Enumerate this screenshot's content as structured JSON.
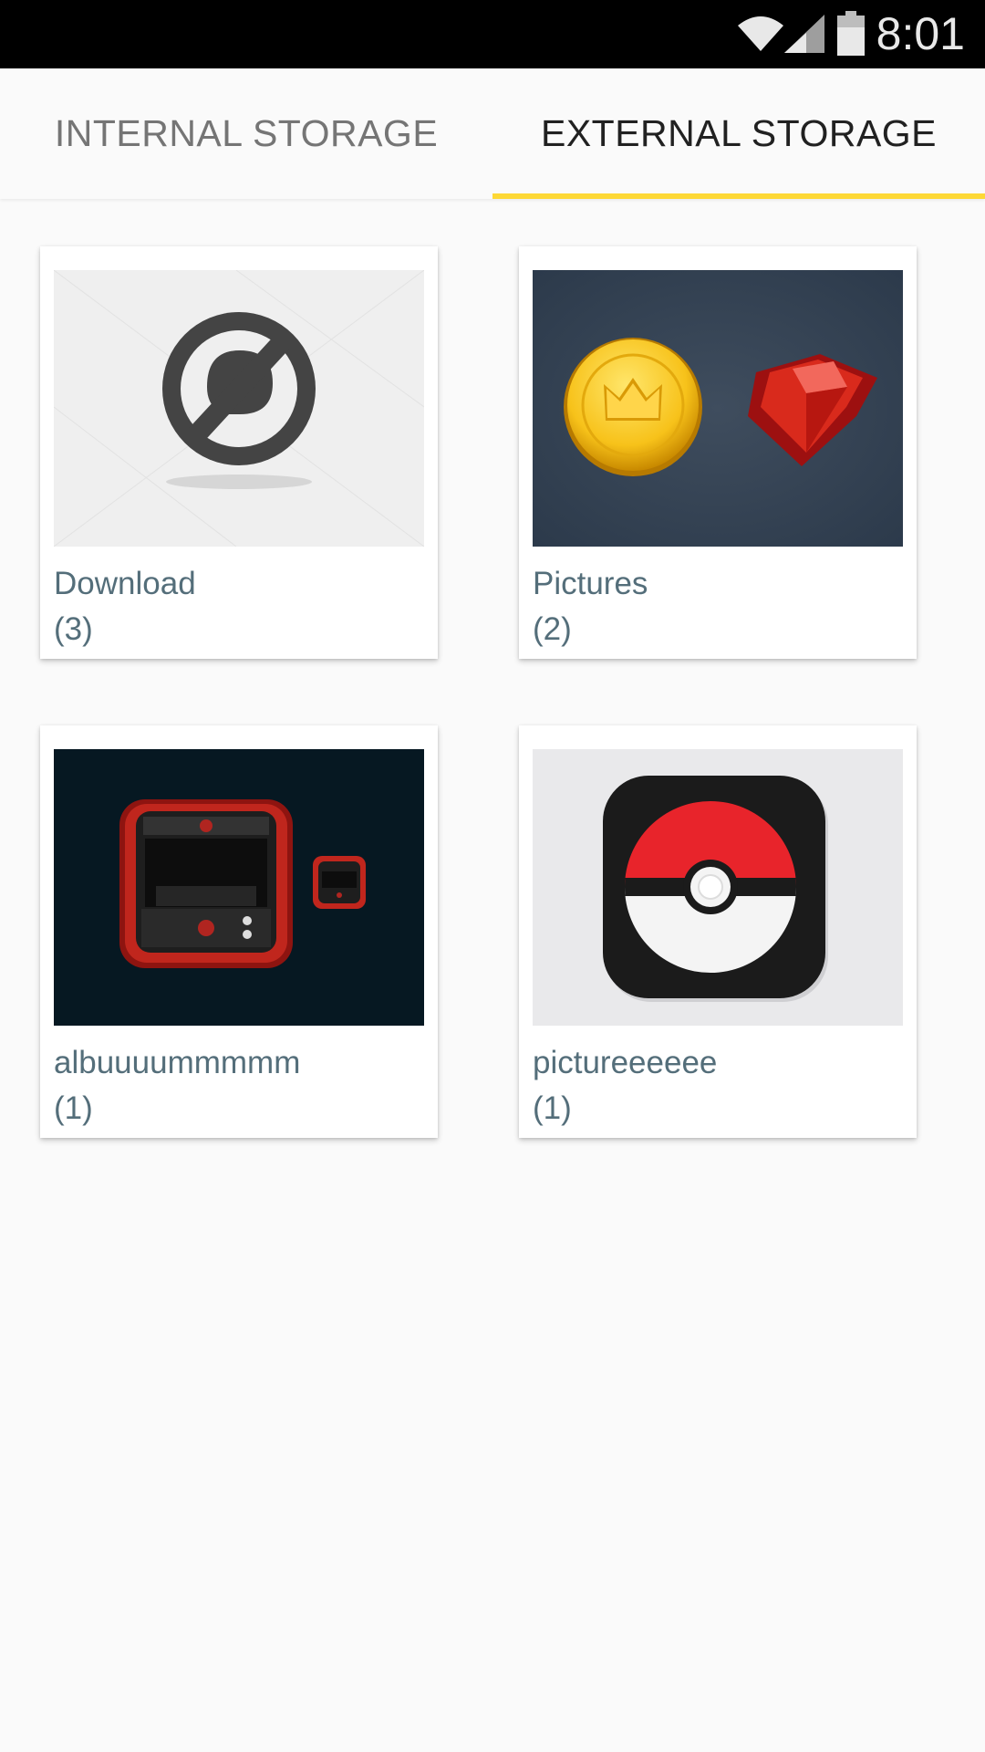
{
  "status_bar": {
    "time": "8:01",
    "icons": [
      "wifi-icon",
      "cell-signal-icon",
      "battery-icon"
    ]
  },
  "tabs": [
    {
      "label": "INTERNAL STORAGE",
      "selected": false
    },
    {
      "label": "EXTERNAL STORAGE",
      "selected": true
    }
  ],
  "colors": {
    "tab_indicator": "#fdd835",
    "album_text": "#546e7a",
    "background": "#fafafa"
  },
  "albums": [
    {
      "name": "Download",
      "count": "(3)",
      "thumbnail": "no-chat-sign-image"
    },
    {
      "name": "Pictures",
      "count": "(2)",
      "thumbnail": "coin-and-ruby-image"
    },
    {
      "name": "albuuuummmmm",
      "count": "(1)",
      "thumbnail": "arcade-cabinet-icon-image"
    },
    {
      "name": "pictureeeeee",
      "count": "(1)",
      "thumbnail": "pokeball-icon-image"
    }
  ]
}
